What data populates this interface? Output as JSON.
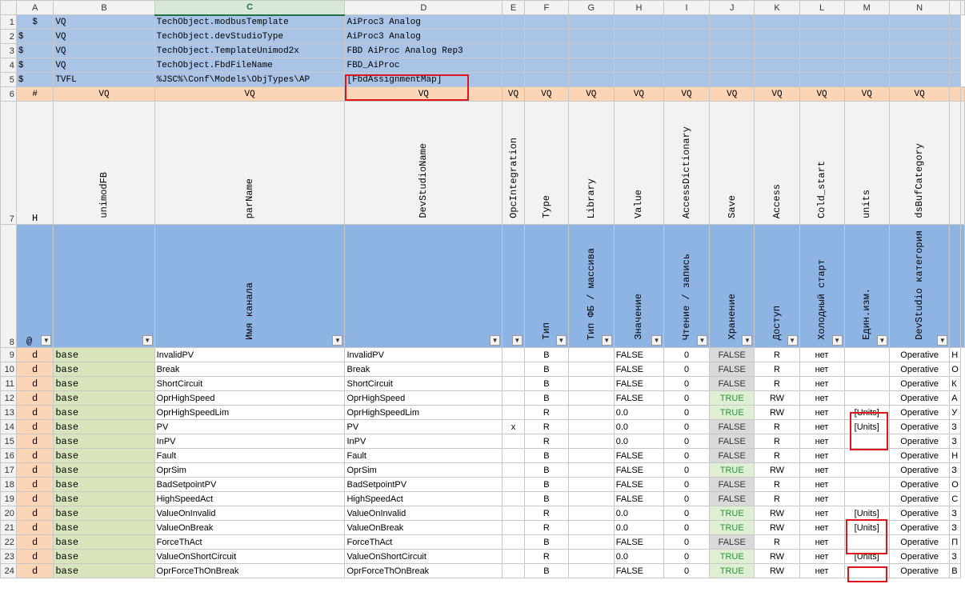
{
  "columns": [
    "A",
    "B",
    "C",
    "D",
    "E",
    "F",
    "G",
    "H",
    "I",
    "J",
    "K",
    "L",
    "M",
    "N"
  ],
  "selected_column": "C",
  "meta_rows": [
    {
      "row": "1",
      "a": "$",
      "b": "VQ",
      "c": "TechObject.modbusTemplate",
      "d": "AiProc3 Analog"
    },
    {
      "row": "2",
      "a": "$",
      "b": "VQ",
      "c": "TechObject.devStudioType",
      "d": "AiProc3 Analog"
    },
    {
      "row": "3",
      "a": "$",
      "b": "VQ",
      "c": "TechObject.TemplateUnimod2x",
      "d": "FBD AiProc Analog Rep3"
    },
    {
      "row": "4",
      "a": "$",
      "b": "VQ",
      "c": "TechObject.FbdFileName",
      "d": "FBD_AiProc"
    },
    {
      "row": "5",
      "a": "$",
      "b": "TVFL",
      "c": "%JSC%\\Conf\\Models\\ObjTypes\\AP",
      "d": "[FbdAssignmentMap]"
    }
  ],
  "row6": {
    "row": "6",
    "cells": [
      "#",
      "VQ",
      "VQ",
      "VQ",
      "VQ",
      "VQ",
      "VQ",
      "VQ",
      "VQ",
      "VQ",
      "VQ",
      "VQ",
      "VQ",
      "VQ"
    ]
  },
  "row7": {
    "row": "7",
    "cells": [
      "H",
      "unimodFB",
      "parName",
      "DevStudioName",
      "OpcIntegration",
      "Type",
      "Library",
      "Value",
      "AccessDictionary",
      "Save",
      "Access",
      "Cold_start",
      "units",
      "dsBufCategory"
    ]
  },
  "row8": {
    "row": "8",
    "cells": [
      "@",
      "",
      "Имя канала",
      "",
      "",
      "Тип",
      "Тип ФБ / массива",
      "Значение",
      "Чтение / запись",
      "Хранение",
      "Доступ",
      "Холодный старт",
      "Един.изм.",
      "DevStudio категория"
    ]
  },
  "data_rows": [
    {
      "row": "9",
      "a": "d",
      "b": "base",
      "c": "InvalidPV",
      "d": "InvalidPV",
      "e": "",
      "f": "B",
      "g": "",
      "h": "FALSE",
      "i": "0",
      "j": "FALSE",
      "k": "R",
      "l": "нет",
      "m": "",
      "n": "Operative",
      "o": "Н"
    },
    {
      "row": "10",
      "a": "d",
      "b": "base",
      "c": "Break",
      "d": "Break",
      "e": "",
      "f": "B",
      "g": "",
      "h": "FALSE",
      "i": "0",
      "j": "FALSE",
      "k": "R",
      "l": "нет",
      "m": "",
      "n": "Operative",
      "o": "О"
    },
    {
      "row": "11",
      "a": "d",
      "b": "base",
      "c": "ShortCircuit",
      "d": "ShortCircuit",
      "e": "",
      "f": "B",
      "g": "",
      "h": "FALSE",
      "i": "0",
      "j": "FALSE",
      "k": "R",
      "l": "нет",
      "m": "",
      "n": "Operative",
      "o": "К"
    },
    {
      "row": "12",
      "a": "d",
      "b": "base",
      "c": "OprHighSpeed",
      "d": "OprHighSpeed",
      "e": "",
      "f": "B",
      "g": "",
      "h": "FALSE",
      "i": "0",
      "j": "TRUE",
      "k": "RW",
      "l": "нет",
      "m": "",
      "n": "Operative",
      "o": "А"
    },
    {
      "row": "13",
      "a": "d",
      "b": "base",
      "c": "OprHighSpeedLim",
      "d": "OprHighSpeedLim",
      "e": "",
      "f": "R",
      "g": "",
      "h": "0.0",
      "i": "0",
      "j": "TRUE",
      "k": "RW",
      "l": "нет",
      "m": "[Units]",
      "n": "Operative",
      "o": "У"
    },
    {
      "row": "14",
      "a": "d",
      "b": "base",
      "c": "PV",
      "d": "PV",
      "e": "x",
      "f": "R",
      "g": "",
      "h": "0.0",
      "i": "0",
      "j": "FALSE",
      "k": "R",
      "l": "нет",
      "m": "[Units]",
      "n": "Operative",
      "o": "З"
    },
    {
      "row": "15",
      "a": "d",
      "b": "base",
      "c": "InPV",
      "d": "InPV",
      "e": "",
      "f": "R",
      "g": "",
      "h": "0.0",
      "i": "0",
      "j": "FALSE",
      "k": "R",
      "l": "нет",
      "m": "",
      "n": "Operative",
      "o": "З"
    },
    {
      "row": "16",
      "a": "d",
      "b": "base",
      "c": "Fault",
      "d": "Fault",
      "e": "",
      "f": "B",
      "g": "",
      "h": "FALSE",
      "i": "0",
      "j": "FALSE",
      "k": "R",
      "l": "нет",
      "m": "",
      "n": "Operative",
      "o": "Н"
    },
    {
      "row": "17",
      "a": "d",
      "b": "base",
      "c": "OprSim",
      "d": "OprSim",
      "e": "",
      "f": "B",
      "g": "",
      "h": "FALSE",
      "i": "0",
      "j": "TRUE",
      "k": "RW",
      "l": "нет",
      "m": "",
      "n": "Operative",
      "o": "З"
    },
    {
      "row": "18",
      "a": "d",
      "b": "base",
      "c": "BadSetpointPV",
      "d": "BadSetpointPV",
      "e": "",
      "f": "B",
      "g": "",
      "h": "FALSE",
      "i": "0",
      "j": "FALSE",
      "k": "R",
      "l": "нет",
      "m": "",
      "n": "Operative",
      "o": "О"
    },
    {
      "row": "19",
      "a": "d",
      "b": "base",
      "c": "HighSpeedAct",
      "d": "HighSpeedAct",
      "e": "",
      "f": "B",
      "g": "",
      "h": "FALSE",
      "i": "0",
      "j": "FALSE",
      "k": "R",
      "l": "нет",
      "m": "",
      "n": "Operative",
      "o": "С"
    },
    {
      "row": "20",
      "a": "d",
      "b": "base",
      "c": "ValueOnInvalid",
      "d": "ValueOnInvalid",
      "e": "",
      "f": "R",
      "g": "",
      "h": "0.0",
      "i": "0",
      "j": "TRUE",
      "k": "RW",
      "l": "нет",
      "m": "[Units]",
      "n": "Operative",
      "o": "З"
    },
    {
      "row": "21",
      "a": "d",
      "b": "base",
      "c": "ValueOnBreak",
      "d": "ValueOnBreak",
      "e": "",
      "f": "R",
      "g": "",
      "h": "0.0",
      "i": "0",
      "j": "TRUE",
      "k": "RW",
      "l": "нет",
      "m": "[Units]",
      "n": "Operative",
      "o": "З"
    },
    {
      "row": "22",
      "a": "d",
      "b": "base",
      "c": "ForceThAct",
      "d": "ForceThAct",
      "e": "",
      "f": "B",
      "g": "",
      "h": "FALSE",
      "i": "0",
      "j": "FALSE",
      "k": "R",
      "l": "нет",
      "m": "",
      "n": "Operative",
      "o": "П"
    },
    {
      "row": "23",
      "a": "d",
      "b": "base",
      "c": "ValueOnShortCircuit",
      "d": "ValueOnShortCircuit",
      "e": "",
      "f": "R",
      "g": "",
      "h": "0.0",
      "i": "0",
      "j": "TRUE",
      "k": "RW",
      "l": "нет",
      "m": "[Units]",
      "n": "Operative",
      "o": "З"
    },
    {
      "row": "24",
      "a": "d",
      "b": "base",
      "c": "OprForceThOnBreak",
      "d": "OprForceThOnBreak",
      "e": "",
      "f": "B",
      "g": "",
      "h": "FALSE",
      "i": "0",
      "j": "TRUE",
      "k": "RW",
      "l": "нет",
      "m": "",
      "n": "Operative",
      "o": "В"
    }
  ],
  "colors": {
    "header_blue": "#8eb4e3",
    "meta_blue": "#a9c4e6",
    "orange": "#fbd5b5",
    "green": "#d8e4bc",
    "true_text": "#1a9c3a",
    "highlight_red": "#e0151b",
    "select_green": "#217346"
  }
}
